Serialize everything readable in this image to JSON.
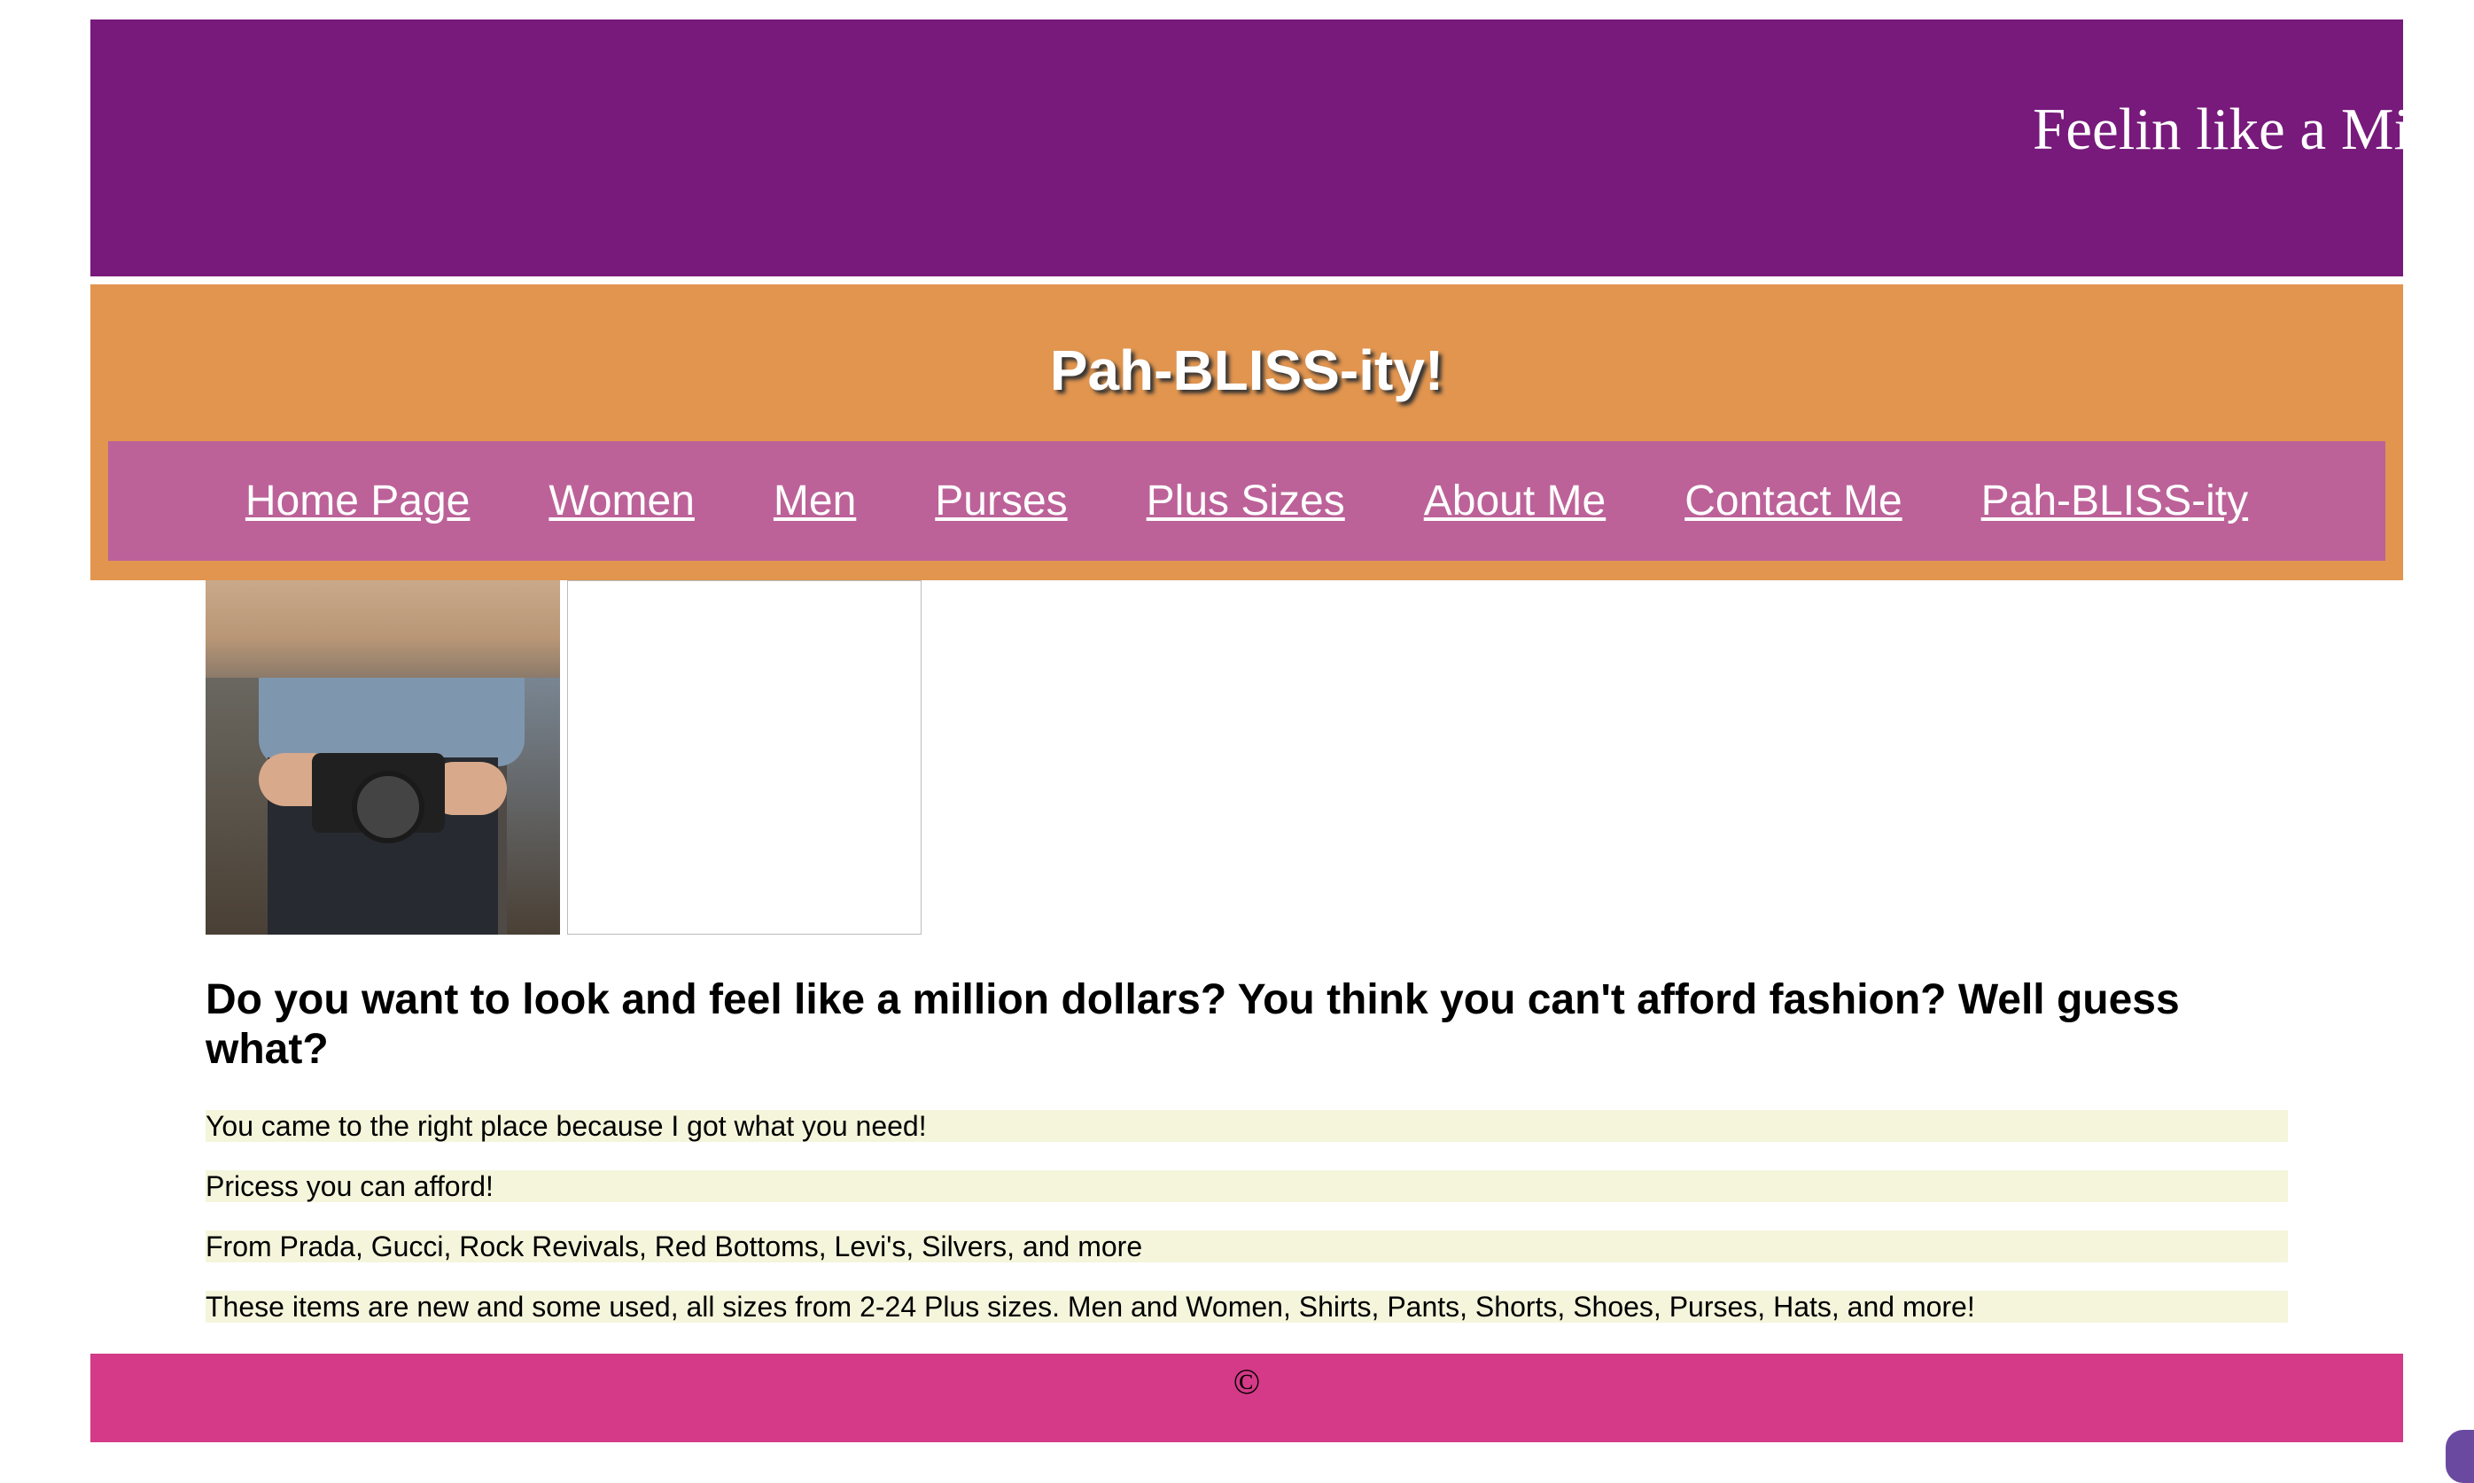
{
  "banner": {
    "marquee_text": "Feelin like a Mi"
  },
  "header": {
    "title": "Pah-BLISS-ity!"
  },
  "nav": {
    "items": [
      {
        "label": "Home Page"
      },
      {
        "label": "Women"
      },
      {
        "label": "Men"
      },
      {
        "label": "Purses"
      },
      {
        "label": "Plus Sizes"
      },
      {
        "label": "About Me"
      },
      {
        "label": "Contact Me"
      },
      {
        "label": "Pah-BLISS-ity"
      }
    ]
  },
  "main": {
    "headline": "Do you want to look and feel like a million dollars? You think you can't afford fashion? Well guess what?",
    "paragraphs": [
      "You came to the right place because I got what you need!",
      "Pricess you can afford!",
      "From Prada, Gucci, Rock Revivals, Red Bottoms, Levi's, Silvers, and more",
      "These items are new and some used, all sizes from 2-24 Plus sizes. Men and Women, Shirts, Pants, Shorts, Shoes, Purses, Hats, and more!"
    ]
  },
  "footer": {
    "copyright": "©"
  },
  "colors": {
    "banner": "#771a7b",
    "header": "#e1954f",
    "nav": "#bc6299",
    "footer": "#d43a87",
    "paragraph_bg": "#f5f5dc"
  }
}
